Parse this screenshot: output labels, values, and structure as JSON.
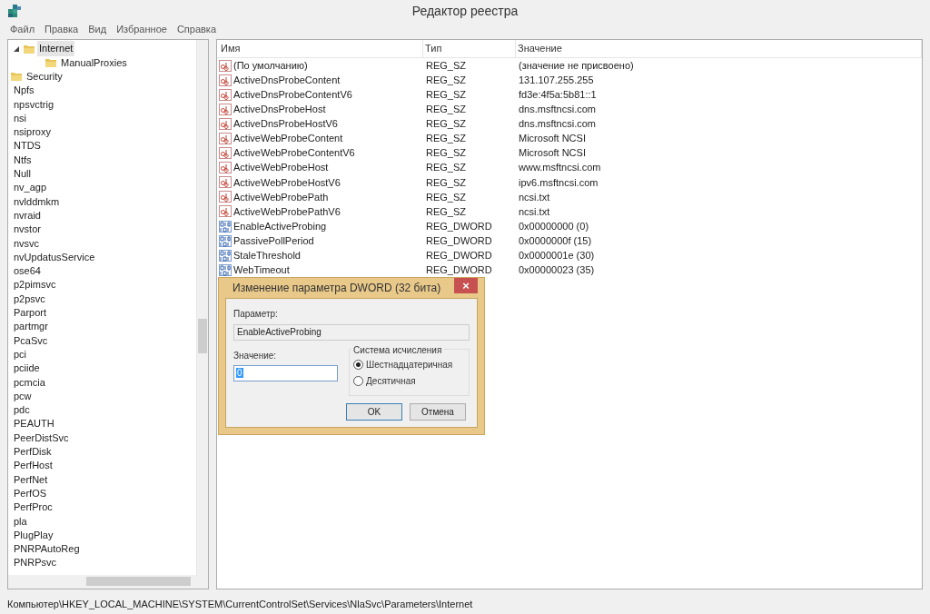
{
  "window": {
    "title": "Редактор реестра"
  },
  "menu": [
    "Файл",
    "Правка",
    "Вид",
    "Избранное",
    "Справка"
  ],
  "tree": {
    "items": [
      {
        "label": "Internet",
        "kind": "folder",
        "expanded": true,
        "selected": true,
        "children": [
          {
            "label": "ManualProxies",
            "kind": "folder",
            "selected": false
          }
        ]
      },
      {
        "label": "Security",
        "kind": "folder",
        "selected": false
      },
      {
        "label": "Npfs",
        "kind": "label",
        "selected": false
      },
      {
        "label": "npsvctrig",
        "kind": "label",
        "selected": false
      },
      {
        "label": "nsi",
        "kind": "label",
        "selected": false
      },
      {
        "label": "nsiproxy",
        "kind": "label",
        "selected": false
      },
      {
        "label": "NTDS",
        "kind": "label",
        "selected": false
      },
      {
        "label": "Ntfs",
        "kind": "label",
        "selected": false
      },
      {
        "label": "Null",
        "kind": "label",
        "selected": false
      },
      {
        "label": "nv_agp",
        "kind": "label",
        "selected": false
      },
      {
        "label": "nvlddmkm",
        "kind": "label",
        "selected": false
      },
      {
        "label": "nvraid",
        "kind": "label",
        "selected": false
      },
      {
        "label": "nvstor",
        "kind": "label",
        "selected": false
      },
      {
        "label": "nvsvc",
        "kind": "label",
        "selected": false
      },
      {
        "label": "nvUpdatusService",
        "kind": "label",
        "selected": false
      },
      {
        "label": "ose64",
        "kind": "label",
        "selected": false
      },
      {
        "label": "p2pimsvc",
        "kind": "label",
        "selected": false
      },
      {
        "label": "p2psvc",
        "kind": "label",
        "selected": false
      },
      {
        "label": "Parport",
        "kind": "label",
        "selected": false
      },
      {
        "label": "partmgr",
        "kind": "label",
        "selected": false
      },
      {
        "label": "PcaSvc",
        "kind": "label",
        "selected": false
      },
      {
        "label": "pci",
        "kind": "label",
        "selected": false
      },
      {
        "label": "pciide",
        "kind": "label",
        "selected": false
      },
      {
        "label": "pcmcia",
        "kind": "label",
        "selected": false
      },
      {
        "label": "pcw",
        "kind": "label",
        "selected": false
      },
      {
        "label": "pdc",
        "kind": "label",
        "selected": false
      },
      {
        "label": "PEAUTH",
        "kind": "label",
        "selected": false
      },
      {
        "label": "PeerDistSvc",
        "kind": "label",
        "selected": false
      },
      {
        "label": "PerfDisk",
        "kind": "label",
        "selected": false
      },
      {
        "label": "PerfHost",
        "kind": "label",
        "selected": false
      },
      {
        "label": "PerfNet",
        "kind": "label",
        "selected": false
      },
      {
        "label": "PerfOS",
        "kind": "label",
        "selected": false
      },
      {
        "label": "PerfProc",
        "kind": "label",
        "selected": false
      },
      {
        "label": "pla",
        "kind": "label",
        "selected": false
      },
      {
        "label": "PlugPlay",
        "kind": "label",
        "selected": false
      },
      {
        "label": "PNRPAutoReg",
        "kind": "label",
        "selected": false
      },
      {
        "label": "PNRPsvc",
        "kind": "label",
        "selected": false
      }
    ]
  },
  "table": {
    "columns": [
      "Имя",
      "Тип",
      "Значение"
    ],
    "rows": [
      {
        "kind": "string",
        "name": "(По умолчанию)",
        "type": "REG_SZ",
        "value": "(значение не присвоено)"
      },
      {
        "kind": "string",
        "name": "ActiveDnsProbeContent",
        "type": "REG_SZ",
        "value": "131.107.255.255"
      },
      {
        "kind": "string",
        "name": "ActiveDnsProbeContentV6",
        "type": "REG_SZ",
        "value": "fd3e:4f5a:5b81::1"
      },
      {
        "kind": "string",
        "name": "ActiveDnsProbeHost",
        "type": "REG_SZ",
        "value": "dns.msftncsi.com"
      },
      {
        "kind": "string",
        "name": "ActiveDnsProbeHostV6",
        "type": "REG_SZ",
        "value": "dns.msftncsi.com"
      },
      {
        "kind": "string",
        "name": "ActiveWebProbeContent",
        "type": "REG_SZ",
        "value": "Microsoft NCSI"
      },
      {
        "kind": "string",
        "name": "ActiveWebProbeContentV6",
        "type": "REG_SZ",
        "value": "Microsoft NCSI"
      },
      {
        "kind": "string",
        "name": "ActiveWebProbeHost",
        "type": "REG_SZ",
        "value": "www.msftncsi.com"
      },
      {
        "kind": "string",
        "name": "ActiveWebProbeHostV6",
        "type": "REG_SZ",
        "value": "ipv6.msftncsi.com"
      },
      {
        "kind": "string",
        "name": "ActiveWebProbePath",
        "type": "REG_SZ",
        "value": "ncsi.txt"
      },
      {
        "kind": "string",
        "name": "ActiveWebProbePathV6",
        "type": "REG_SZ",
        "value": "ncsi.txt"
      },
      {
        "kind": "binary",
        "name": "EnableActiveProbing",
        "type": "REG_DWORD",
        "value": "0x00000000 (0)"
      },
      {
        "kind": "binary",
        "name": "PassivePollPeriod",
        "type": "REG_DWORD",
        "value": "0x0000000f (15)"
      },
      {
        "kind": "binary",
        "name": "StaleThreshold",
        "type": "REG_DWORD",
        "value": "0x0000001e (30)"
      },
      {
        "kind": "binary",
        "name": "WebTimeout",
        "type": "REG_DWORD",
        "value": "0x00000023 (35)"
      }
    ]
  },
  "dialog": {
    "title": "Изменение параметра DWORD (32 бита)",
    "close": "×",
    "param_label": "Параметр:",
    "param_value": "EnableActiveProbing",
    "value_label": "Значение:",
    "value": "0",
    "base_group": "Система исчисления",
    "bases": [
      {
        "label": "Шестнадцатеричная",
        "selected": true
      },
      {
        "label": "Десятичная",
        "selected": false
      }
    ],
    "buttons": [
      "OK",
      "Отмена"
    ]
  },
  "status_bar": "Компьютер\\HKEY_LOCAL_MACHINE\\SYSTEM\\CurrentControlSet\\Services\\NlaSvc\\Parameters\\Internet"
}
